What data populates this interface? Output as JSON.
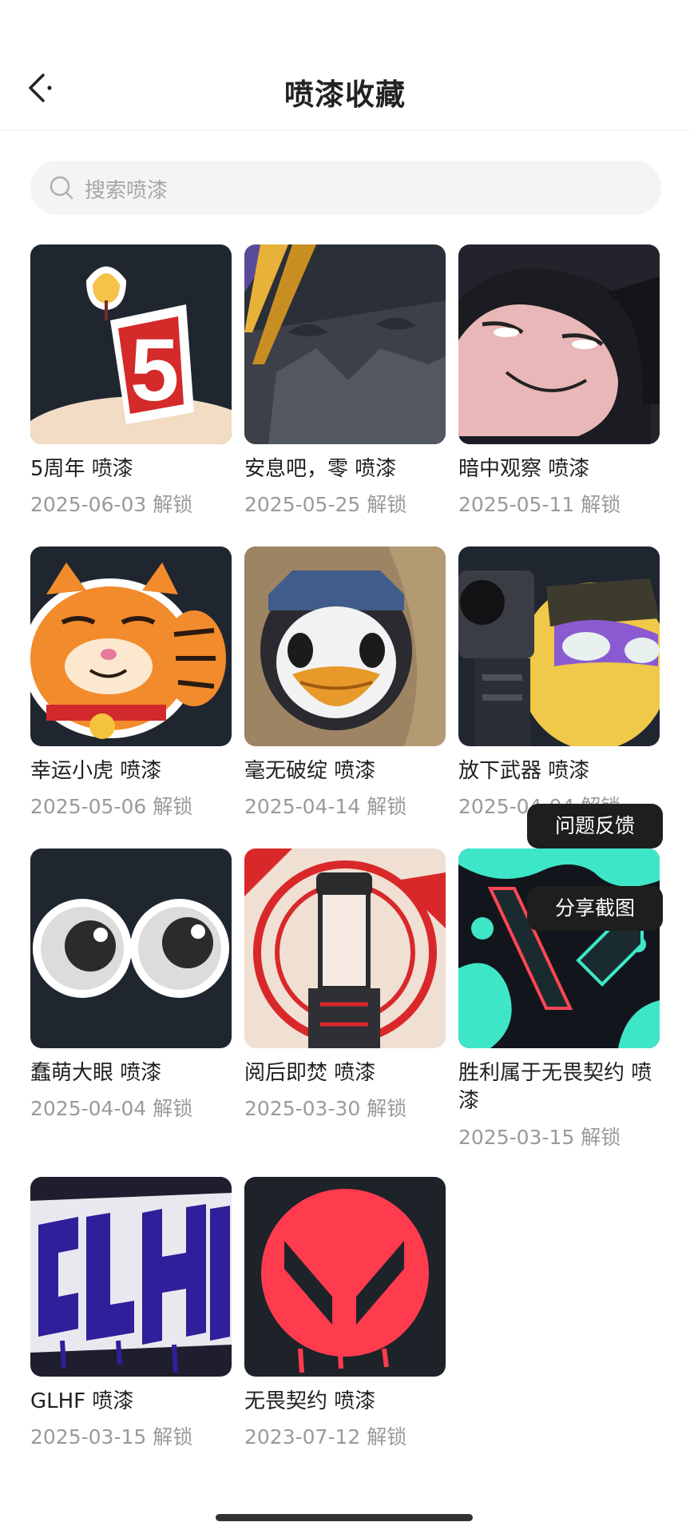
{
  "header": {
    "title": "喷漆收藏"
  },
  "search": {
    "placeholder": "搜索喷漆"
  },
  "items": [
    {
      "name": "5周年 喷漆",
      "date": "2025-06-03 解锁"
    },
    {
      "name": "安息吧，零 喷漆",
      "date": "2025-05-25 解锁"
    },
    {
      "name": "暗中观察 喷漆",
      "date": "2025-05-11 解锁"
    },
    {
      "name": "幸运小虎 喷漆",
      "date": "2025-05-06 解锁"
    },
    {
      "name": "毫无破绽 喷漆",
      "date": "2025-04-14 解锁"
    },
    {
      "name": "放下武器 喷漆",
      "date": "2025-04-04 解锁"
    },
    {
      "name": "蠢萌大眼 喷漆",
      "date": "2025-04-04 解锁"
    },
    {
      "name": "阅后即焚 喷漆",
      "date": "2025-03-30 解锁"
    },
    {
      "name": "胜利属于无畏契约 喷漆",
      "date": "2025-03-15 解锁"
    },
    {
      "name": "GLHF 喷漆",
      "date": "2025-03-15 解锁"
    },
    {
      "name": "无畏契约 喷漆",
      "date": "2023-07-12 解锁"
    }
  ],
  "floating": {
    "feedback": "问题反馈",
    "share": "分享截图"
  },
  "colors": {
    "accent": "#ff4655",
    "tile_dark": "#1f2630",
    "teal": "#3ee6c8"
  }
}
